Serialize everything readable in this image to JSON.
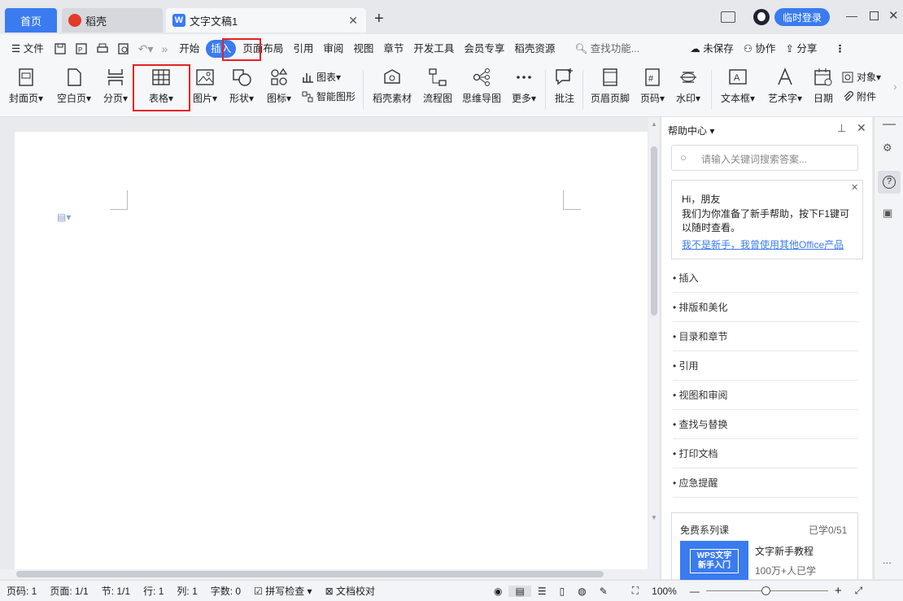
{
  "tabs": {
    "home": "首页",
    "daoke": "稻壳",
    "doc": "文字文稿1"
  },
  "title_actions": {
    "login": "临时登录"
  },
  "menubar": {
    "file": "文件",
    "start": "开始",
    "insert": "插入",
    "layout": "页面布局",
    "ref": "引用",
    "review": "审阅",
    "view": "视图",
    "chapter": "章节",
    "dev": "开发工具",
    "vip": "会员专享",
    "daoke_res": "稻壳资源",
    "search": "查找功能...",
    "unsaved": "未保存",
    "collab": "协作",
    "share": "分享"
  },
  "ribbon": {
    "cover": "封面页",
    "blank": "空白页",
    "pagebreak": "分页",
    "table": "表格",
    "picture": "图片",
    "shape": "形状",
    "icon": "图标",
    "chart": "图表",
    "smartart": "智能图形",
    "daoke_mat": "稻壳素材",
    "flowchart": "流程图",
    "mindmap": "思维导图",
    "more": "更多",
    "comment": "批注",
    "header_footer": "页眉页脚",
    "page_num": "页码",
    "watermark": "水印",
    "textbox": "文本框",
    "wordart": "艺术字",
    "date": "日期",
    "object": "对象",
    "attach": "附件"
  },
  "help": {
    "title": "帮助中心",
    "search_placeholder": "请输入关键词搜索答案...",
    "greet": "Hi，朋友",
    "intro": "我们为你准备了新手帮助，按下F1键可以随时查看。",
    "link": "我不是新手，我曾使用其他Office产品",
    "items": [
      "插入",
      "排版和美化",
      "目录和章节",
      "引用",
      "视图和审阅",
      "查找与替换",
      "打印文档",
      "应急提醒"
    ],
    "course_title": "免费系列课",
    "course_progress": "已学0/51",
    "course_thumb1": "WPS文字",
    "course_thumb2": "新手入门",
    "course_name": "文字新手教程",
    "course_learners": "100万+人已学"
  },
  "status": {
    "page": "页码: 1",
    "pages": "页面: 1/1",
    "section": "节: 1/1",
    "row": "行: 1",
    "col": "列: 1",
    "words": "字数: 0",
    "spell": "拼写检查",
    "proof": "文档校对",
    "zoom": "100%"
  },
  "colors": {
    "accent": "#3a7bf0",
    "highlight": "#e52222"
  }
}
